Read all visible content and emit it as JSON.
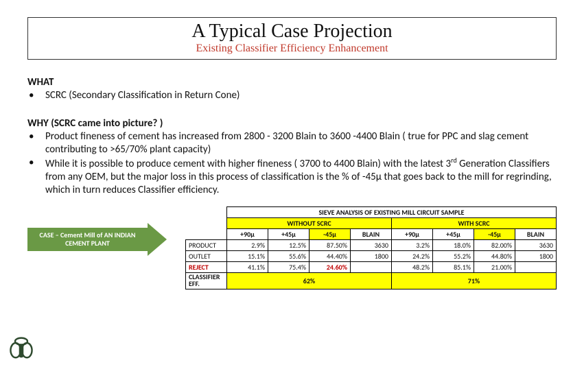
{
  "title": "A Typical Case Projection",
  "subtitle": "Existing Classifier Efficiency Enhancement",
  "what_head": "WHAT",
  "what_bullets": [
    "SCRC (Secondary Classification in Return Cone)"
  ],
  "why_head": "WHY (SCRC came into picture? )",
  "why_bullets": [
    "Product  fineness of  cement  has increased from  2800 - 3200 Blain to 3600 -4400 Blain    ( true for PPC and slag cement contributing to >65/70% plant capacity)",
    "While it is possible to produce cement with higher fineness ( 3700 to 4400 Blain) with the latest 3rd Generation Classifiers from any OEM, but the major loss in this process of classification is the % of -45µ that goes back to the mill for regrinding, which in turn reduces Classifier efficiency."
  ],
  "case_arrow": "CASE – Cement Mill of AN INDIAN CEMENT PLANT",
  "table": {
    "super_title": "SIEVE ANALYSIS OF EXISTING MILL CIRCUIT SAMPLE",
    "without": "WITHOUT SCRC",
    "with": "WITH SCRC",
    "cols": [
      "+90µ",
      "+45µ",
      "-45µ",
      "BLAIN",
      "+90µ",
      "+45µ",
      "-45µ",
      "BLAIN"
    ],
    "rows": [
      {
        "label": "PRODUCT",
        "cells": [
          "2.9%",
          "12.5%",
          "87.50%",
          "3630",
          "3.2%",
          "18.0%",
          "82.00%",
          "3630"
        ]
      },
      {
        "label": "OUTLET",
        "cells": [
          "15.1%",
          "55.6%",
          "44.40%",
          "1800",
          "24.2%",
          "55.2%",
          "44.80%",
          "1800"
        ]
      },
      {
        "label": "REJECT",
        "cells": [
          "41.1%",
          "75.4%",
          "24.60%",
          "",
          "48.2%",
          "85.1%",
          "21.00%",
          ""
        ]
      }
    ],
    "eff_label": "CLASSIFIER EFF.",
    "eff_without": "62%",
    "eff_with": "71%"
  },
  "chart_data": {
    "type": "table",
    "title": "SIEVE ANALYSIS OF EXISTING MILL CIRCUIT SAMPLE",
    "groups": [
      "WITHOUT SCRC",
      "WITH SCRC"
    ],
    "columns": [
      "+90µ",
      "+45µ",
      "-45µ",
      "BLAIN"
    ],
    "rows": {
      "PRODUCT": {
        "WITHOUT SCRC": [
          2.9,
          12.5,
          87.5,
          3630
        ],
        "WITH SCRC": [
          3.2,
          18.0,
          82.0,
          3630
        ]
      },
      "OUTLET": {
        "WITHOUT SCRC": [
          15.1,
          55.6,
          44.4,
          1800
        ],
        "WITH SCRC": [
          24.2,
          55.2,
          44.8,
          1800
        ]
      },
      "REJECT": {
        "WITHOUT SCRC": [
          41.1,
          75.4,
          24.6,
          null
        ],
        "WITH SCRC": [
          48.2,
          85.1,
          21.0,
          null
        ]
      }
    },
    "classifier_eff": {
      "WITHOUT SCRC": 62,
      "WITH SCRC": 71
    }
  }
}
